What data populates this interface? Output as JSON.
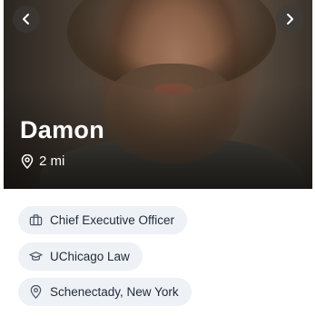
{
  "profile": {
    "name": "Damon",
    "distance": "2 mi"
  },
  "details": {
    "job": "Chief Executive Officer",
    "education": "UChicago Law",
    "location": "Schenectady, New York"
  },
  "icons": {
    "prev": "chevron-left-icon",
    "next": "chevron-right-icon",
    "distance": "location-pin-icon",
    "job": "briefcase-icon",
    "education": "graduation-cap-icon",
    "location": "location-pin-icon"
  },
  "colors": {
    "chip_background": "#eef1f6",
    "chip_text": "#1f2a37",
    "overlay_text": "#ffffff"
  }
}
